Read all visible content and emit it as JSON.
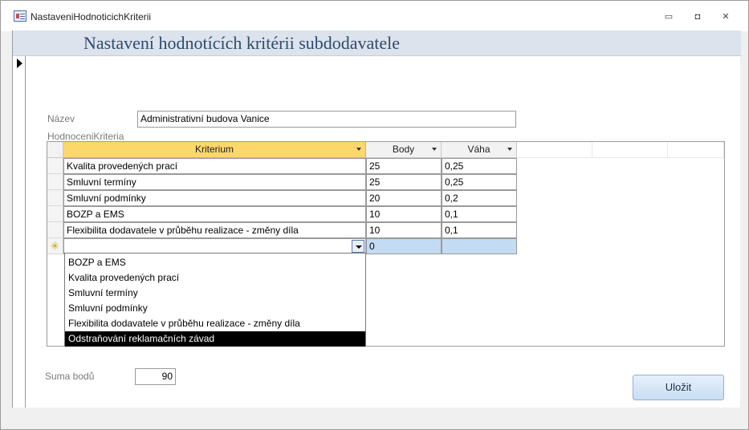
{
  "window": {
    "title": "NastaveniHodnoticichKriterii",
    "controls": {
      "minimize": "▭",
      "restore": "◘",
      "close": "✕"
    }
  },
  "form": {
    "heading": "Nastavení hodnotících kritérii subdodavatele",
    "name_label": "Název",
    "name_value": "Administrativní budova Vanice",
    "subform_label": "HodnoceniKriteria",
    "sum_label": "Suma bodů",
    "sum_value": "90",
    "save_label": "Uložit"
  },
  "grid": {
    "columns": [
      "Kriterium",
      "Body",
      "Váha"
    ],
    "rows": [
      {
        "kriterium": "Kvalita provedených prací",
        "body": "25",
        "vaha": "0,25"
      },
      {
        "kriterium": "Smluvní termíny",
        "body": "25",
        "vaha": "0,25"
      },
      {
        "kriterium": "Smluvní podmínky",
        "body": "20",
        "vaha": "0,2"
      },
      {
        "kriterium": "BOZP a EMS",
        "body": "10",
        "vaha": "0,1"
      },
      {
        "kriterium": "Flexibilita dodavatele v průběhu realizace - změny díla",
        "body": "10",
        "vaha": "0,1"
      }
    ],
    "new_row": {
      "marker": "✳",
      "kriterium": "",
      "body": "0",
      "vaha": ""
    }
  },
  "dropdown": {
    "options": [
      "BOZP a EMS",
      "Kvalita provedených prací",
      "Smluvní termíny",
      "Smluvní podmínky",
      "Flexibilita dodavatele v průběhu realizace - změny díla",
      "Odstraňování reklamačních závad"
    ],
    "highlighted_index": 5
  },
  "colors": {
    "header_band": "#dce3ec",
    "heading_text": "#2f4a6e",
    "active_column": "#fcd86a",
    "selection": "#c4dbf4"
  }
}
